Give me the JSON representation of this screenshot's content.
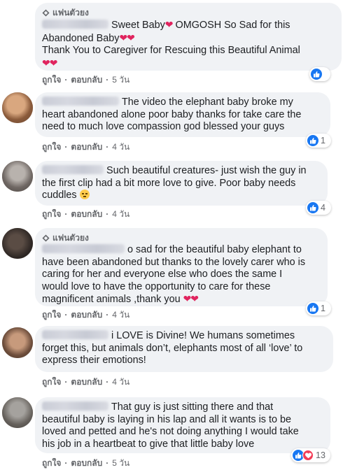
{
  "labels": {
    "top_fan": "แฟนตัวยง",
    "like": "ถูกใจ",
    "reply": "ตอบกลับ",
    "separator": "·"
  },
  "colors": {
    "bubble": "#f0f2f5",
    "like_blue": "#1877f2",
    "love_red": "#f33e58",
    "heart": "#e0245e",
    "meta_gray": "#65676b"
  },
  "comments": [
    {
      "top_fan": true,
      "text_html": "Sweet Baby",
      "line1": "Sweet Baby",
      "line1b": " OMGOSH So Sad for this",
      "line2": "Abandoned Baby",
      "line3": "Thank You to Caregiver for Rescuing this Beautiful Animal",
      "reaction_count": "",
      "reactions": [
        "like-icon"
      ],
      "time": "5 วัน"
    },
    {
      "top_fan": false,
      "line1": "The video the elephant baby broke my",
      "line2": "heart abandoned alone poor baby thanks for take care the",
      "line3": "need to much love compassion god blessed your guys",
      "reaction_count": "1",
      "reactions": [
        "like-icon"
      ],
      "time": "4 วัน"
    },
    {
      "top_fan": false,
      "line1": "Such beautiful creatures- just wish the guy in",
      "line2": "the first clip had a bit more love to give. Poor baby needs",
      "line3": "cuddles",
      "reaction_count": "4",
      "reactions": [
        "like-icon"
      ],
      "time": "4 วัน"
    },
    {
      "top_fan": true,
      "line1": "o sad for the beautiful baby elephant to",
      "line2": "have been abandoned but thanks to the lovely carer who is",
      "line3": "caring for her and everyone else who does the same I",
      "line4": "would love to have the opportunity to care for these",
      "line5": "magnificent animals ,thank you",
      "reaction_count": "1",
      "reactions": [
        "like-icon"
      ],
      "time": "4 วัน"
    },
    {
      "top_fan": false,
      "line1": "i LOVE is Divine! We humans sometimes",
      "line2": "forget this, but animals don’t, elephants most of all ‘love’ to",
      "line3": "express their emotions!",
      "reaction_count": "",
      "reactions": [],
      "time": "4 วัน"
    },
    {
      "top_fan": false,
      "line1": "That guy is just sitting there and that",
      "line2": "beautiful baby is laying in his lap and all it wants is to be",
      "line3": "loved and petted and he's not doing anything I would take",
      "line4": "his job in a heartbeat to give that little baby love",
      "reaction_count": "13",
      "reactions": [
        "like-icon",
        "love-icon"
      ],
      "time": "5 วัน"
    }
  ]
}
